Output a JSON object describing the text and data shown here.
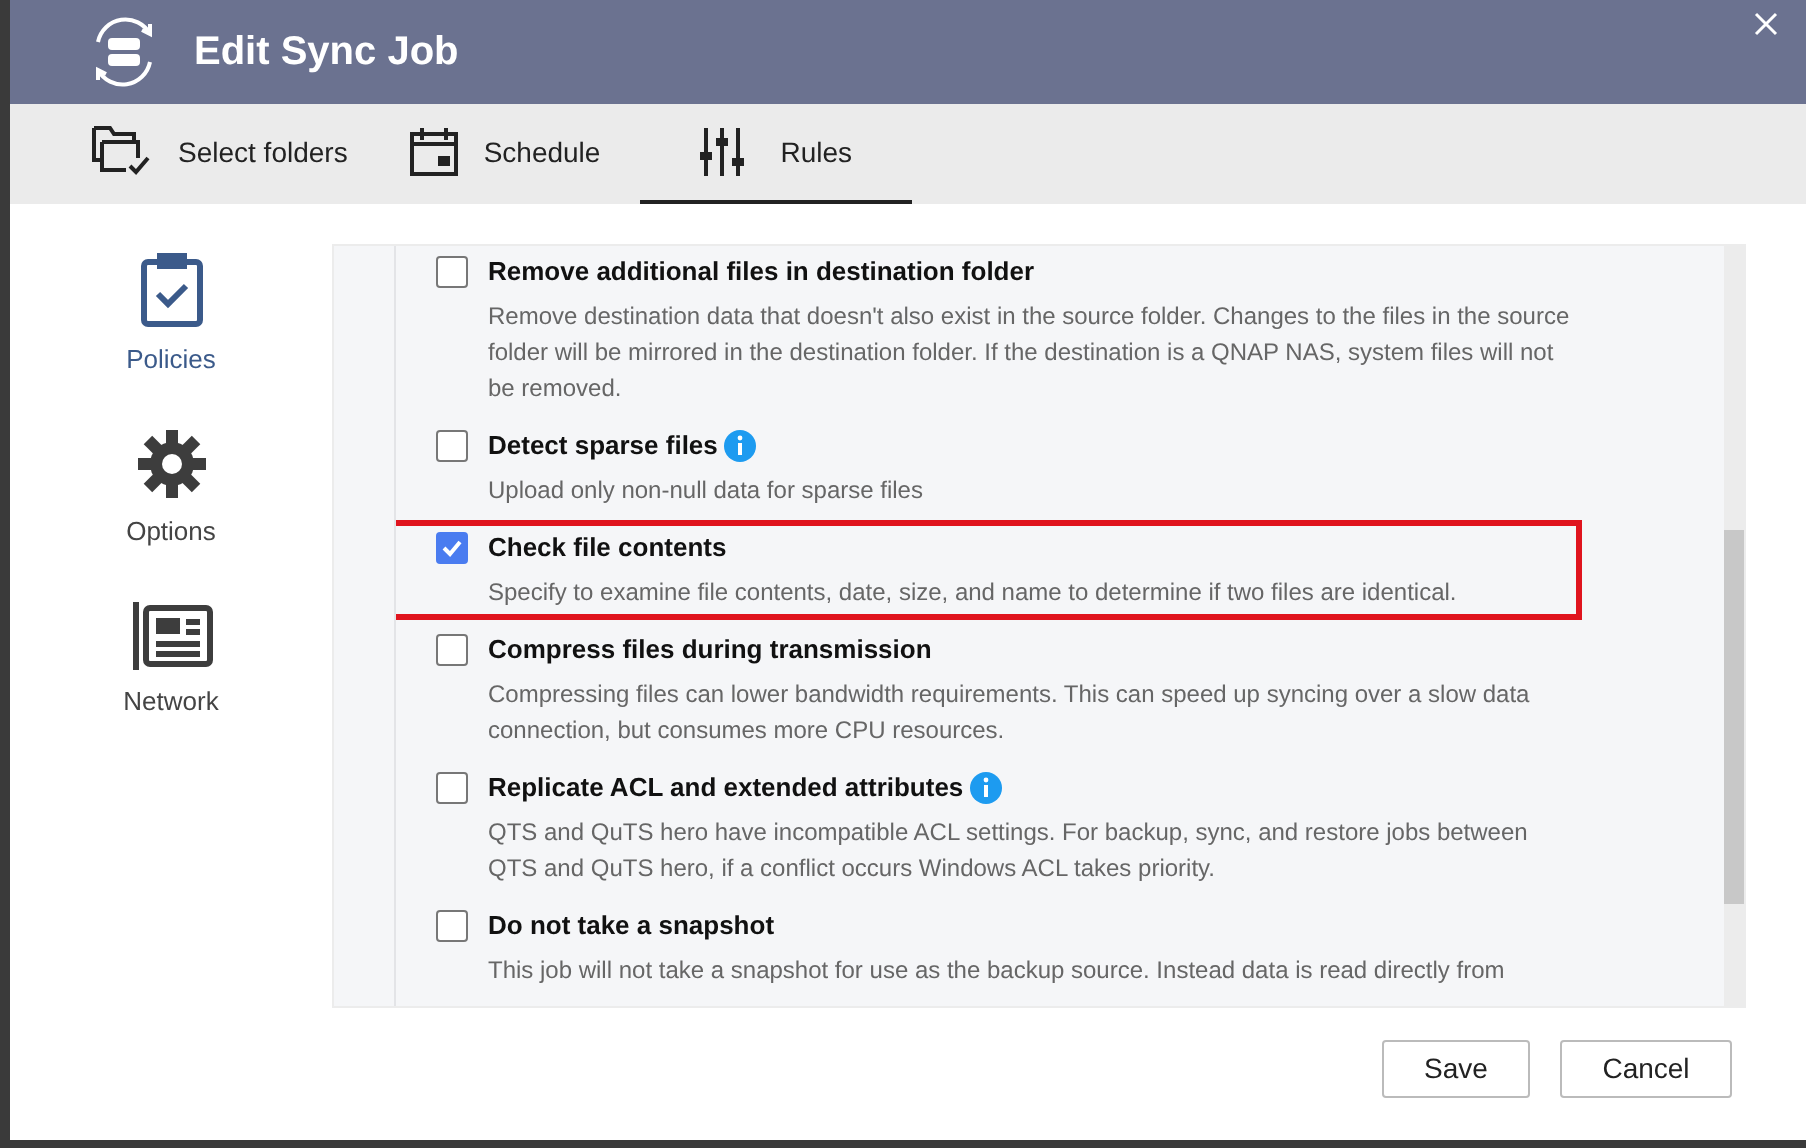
{
  "window": {
    "title": "Edit Sync Job"
  },
  "tabs": [
    {
      "label": "Select folders",
      "selected": false
    },
    {
      "label": "Schedule",
      "selected": false
    },
    {
      "label": "Rules",
      "selected": true
    }
  ],
  "sidebar": {
    "items": [
      {
        "label": "Policies",
        "selected": true
      },
      {
        "label": "Options",
        "selected": false
      },
      {
        "label": "Network",
        "selected": false
      }
    ]
  },
  "options": [
    {
      "title": "Remove additional files in destination folder",
      "checked": false,
      "info": false,
      "highlighted": false,
      "description": "Remove destination data that doesn't also exist in the source folder. Changes to the files in the source folder will be mirrored in the destination folder. If the destination is a QNAP NAS, system files will not be removed."
    },
    {
      "title": "Detect sparse files",
      "checked": false,
      "info": true,
      "highlighted": false,
      "description": "Upload only non-null data for sparse files"
    },
    {
      "title": "Check file contents",
      "checked": true,
      "info": false,
      "highlighted": true,
      "description": "Specify to examine file contents, date, size, and name to determine if two files are identical."
    },
    {
      "title": "Compress files during transmission",
      "checked": false,
      "info": false,
      "highlighted": false,
      "description": "Compressing files can lower bandwidth requirements. This can speed up syncing over a slow data connection, but consumes more CPU resources."
    },
    {
      "title": "Replicate ACL and extended attributes",
      "checked": false,
      "info": true,
      "highlighted": false,
      "description": "QTS and QuTS hero have incompatible ACL settings. For backup, sync, and restore jobs between QTS and QuTS hero, if a conflict occurs Windows ACL takes priority."
    },
    {
      "title": "Do not take a snapshot",
      "checked": false,
      "info": false,
      "highlighted": false,
      "description": "This job will not take a snapshot for use as the backup source. Instead data is read directly from"
    }
  ],
  "buttons": [
    {
      "label": "Save"
    },
    {
      "label": "Cancel"
    }
  ]
}
